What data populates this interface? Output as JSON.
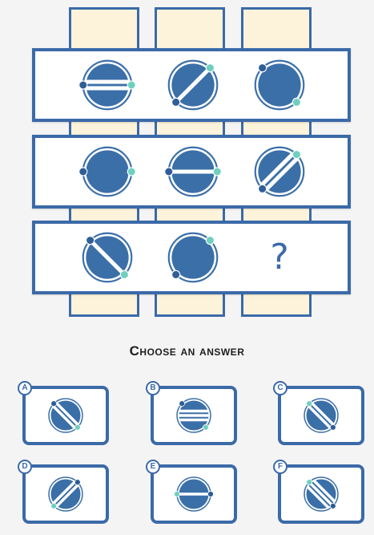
{
  "colors": {
    "frame": "#3b6aa8",
    "disk": "#3b6fa8",
    "ring": "#ffffff",
    "dot_dark": "#2f5d96",
    "dot_light": "#6fd0bf",
    "column_fill": "#fdf3da"
  },
  "matrix": [
    [
      {
        "stripes": "horizontal-2",
        "dark_dot": "left",
        "light_dot": "right"
      },
      {
        "stripes": "diagonal-1",
        "dark_dot": "bottom-left",
        "light_dot": "top-right"
      },
      {
        "stripes": "none",
        "dark_dot": "top-left",
        "light_dot": "bottom-right"
      }
    ],
    [
      {
        "stripes": "none",
        "dark_dot": "left",
        "light_dot": "right"
      },
      {
        "stripes": "horizontal-1",
        "dark_dot": "left",
        "light_dot": "right"
      },
      {
        "stripes": "diagonal-2",
        "dark_dot": "bottom-left",
        "light_dot": "top-right"
      }
    ],
    [
      {
        "stripes": "anti-diagonal-1",
        "dark_dot": "top-left",
        "light_dot": "bottom-right"
      },
      {
        "stripes": "none",
        "dark_dot": "bottom-left",
        "light_dot": "top-right"
      },
      {
        "missing": true
      }
    ]
  ],
  "missing_symbol": "?",
  "prompt": "Choose an answer",
  "options": [
    {
      "letter": "A",
      "stripes": "anti-diagonal-2",
      "dark_dot": "top-left",
      "light_dot": "bottom-right"
    },
    {
      "letter": "B",
      "stripes": "horizontal-3",
      "dark_dot": "top-left",
      "light_dot": "bottom-right"
    },
    {
      "letter": "C",
      "stripes": "anti-diagonal-2",
      "dark_dot": "bottom-right",
      "light_dot": "top-left"
    },
    {
      "letter": "D",
      "stripes": "diagonal-2",
      "dark_dot": "top-right",
      "light_dot": "bottom-left"
    },
    {
      "letter": "E",
      "stripes": "horizontal-1",
      "dark_dot": "right",
      "light_dot": "left"
    },
    {
      "letter": "F",
      "stripes": "anti-diagonal-3",
      "dark_dot": "bottom-right",
      "light_dot": "top-left"
    }
  ]
}
